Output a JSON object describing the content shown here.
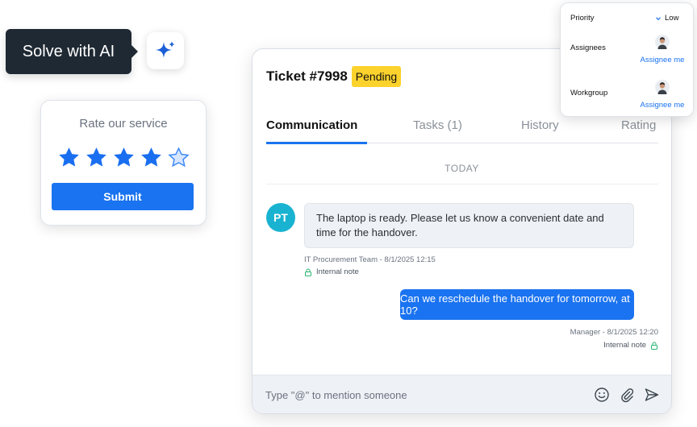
{
  "ai": {
    "label": "Solve with AI",
    "icon": "sparkle-icon"
  },
  "rating": {
    "title": "Rate our service",
    "value": 4,
    "max": 5,
    "submit_label": "Submit"
  },
  "ticket": {
    "title": "Ticket #7998",
    "status": "Pending",
    "tabs": [
      {
        "label": "Communication",
        "active": true
      },
      {
        "label": "Tasks (1)",
        "active": false
      },
      {
        "label": "History",
        "active": false
      },
      {
        "label": "Rating",
        "active": false
      }
    ],
    "day_separator": "TODAY",
    "messages": [
      {
        "avatar": "PT",
        "text": "The laptop is ready. Please let us know a convenient date and time for the handover.",
        "meta": "IT Procurement Team - 8/1/2025 12:15",
        "note": "Internal note"
      },
      {
        "text": "Can we reschedule the handover for tomorrow, at 10?",
        "meta": "Manager - 8/1/2025 12:20",
        "note": "Internal note"
      }
    ],
    "composer": {
      "placeholder": "Type \"@\" to mention someone"
    }
  },
  "properties": {
    "priority_label": "Priority",
    "priority_value": "Low",
    "assignees_label": "Assignees",
    "assignees_link": "Assignee me",
    "workgroup_label": "Workgroup",
    "workgroup_link": "Assignee me"
  },
  "colors": {
    "accent": "#1a73f0",
    "pending": "#fcd22c",
    "avatar_pt": "#19b3d1",
    "tooltip": "#1f2933"
  }
}
